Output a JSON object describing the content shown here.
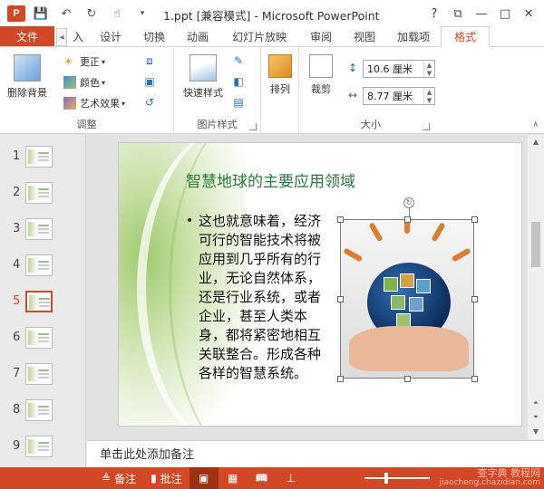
{
  "titlebar": {
    "app_badge": "P",
    "title": "1.ppt [兼容模式] - Microsoft PowerPoint",
    "help": "?",
    "restore": "⧉",
    "minimize": "—",
    "maximize": "□",
    "close": "✕"
  },
  "tabs": {
    "file": "文件",
    "items": [
      "入",
      "设计",
      "切换",
      "动画",
      "幻灯片放映",
      "审阅",
      "视图",
      "加载项",
      "格式"
    ],
    "active": "格式"
  },
  "ribbon": {
    "adjust": {
      "remove_bg": "删除背景",
      "correct": "更正",
      "color": "颜色",
      "art": "艺术效果",
      "label": "调整"
    },
    "picture_style": {
      "quick": "快速样式",
      "label": "图片样式"
    },
    "arrange": {
      "arrange": "排列"
    },
    "size": {
      "crop": "裁剪",
      "height": "10.6 厘米",
      "width": "8.77 厘米",
      "label": "大小"
    }
  },
  "thumbnails": [
    "1",
    "2",
    "3",
    "4",
    "5",
    "6",
    "7",
    "8",
    "9"
  ],
  "selected_slide": "5",
  "slide": {
    "title": "智慧地球的主要应用领域",
    "body": "这也就意味着，经济可行的智能技术将被应用到几乎所有的行业，无论自然体系，还是行业系统，或者企业，甚至人类本身，都将紧密地相互关联整合。形成各种各样的智慧系统。",
    "bullet": "•"
  },
  "notes": {
    "placeholder": "单击此处添加备注"
  },
  "statusbar": {
    "notes": "备注",
    "comments": "批注"
  },
  "watermark": {
    "line1": "查字典 教程网",
    "line2": "jiaocheng.chazidian.com"
  },
  "colors": {
    "accent": "#d24726",
    "title_green": "#2b7a3f"
  }
}
